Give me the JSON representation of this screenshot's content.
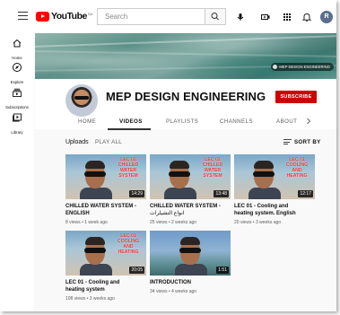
{
  "topbar": {
    "logo_text": "YouTube",
    "logo_country": "SA",
    "search_placeholder": "Search",
    "avatar_letter": "R"
  },
  "sidebar": {
    "items": [
      {
        "label": "Home",
        "icon": "home-icon"
      },
      {
        "label": "Explore",
        "icon": "compass-icon"
      },
      {
        "label": "Subscriptions",
        "icon": "subscriptions-icon"
      },
      {
        "label": "Library",
        "icon": "library-icon"
      }
    ]
  },
  "banner": {
    "badge_text": "MEP DESIGN ENGINEERING"
  },
  "channel": {
    "name": "MEP DESIGN ENGINEERING",
    "subscribe_label": "SUBSCRIBE",
    "tabs": [
      "HOME",
      "VIDEOS",
      "PLAYLISTS",
      "CHANNELS",
      "ABOUT"
    ],
    "active_tab": "VIDEOS"
  },
  "content": {
    "section_title": "Uploads",
    "play_all_label": "PLAY ALL",
    "sort_label": "SORT BY",
    "videos": [
      {
        "title_line1": "CHILLED WATER SYSTEM -",
        "title_line2": "ENGLISH",
        "meta": "8 views • 1 week ago",
        "duration": "14:29",
        "overlay": "LEC 02 CHILLED WATER SYSTEM"
      },
      {
        "title_line1": "CHILLED WATER SYSTEM -",
        "title_line2": "انواع التشيلرات",
        "meta": "25 views • 2 weeks ago",
        "duration": "13:48",
        "overlay": "LEC 02 CHILLED WATER SYSTEM"
      },
      {
        "title_line1": "LEC 01 - Cooling and",
        "title_line2": "heating system. English",
        "meta": "20 views • 3 weeks ago",
        "duration": "12:17",
        "overlay": "LEC 01 COOLING AND HEATING"
      },
      {
        "title_line1": "LEC 01 - Cooling and",
        "title_line2": "heating system",
        "meta": "108 views • 3 weeks ago",
        "duration": "20:05",
        "overlay": "LEC 01 COOLING AND HEATING"
      },
      {
        "title_line1": "INTRODUCTION",
        "title_line2": "",
        "meta": "34 views • 4 weeks ago",
        "duration": "1:51",
        "overlay": ""
      }
    ]
  },
  "colors": {
    "brand_red": "#ff0000",
    "subscribe_red": "#cc0000",
    "text_primary": "#0f0f0f",
    "text_secondary": "#606060"
  }
}
